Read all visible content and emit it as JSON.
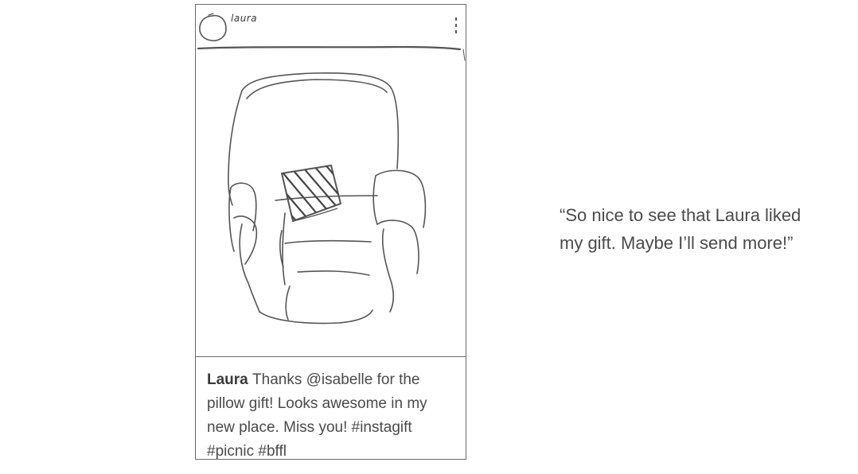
{
  "post": {
    "sketch_username": "laura",
    "caption_user": "Laura",
    "caption_text": "Thanks @isabelle for the pillow gift! Looks awesome in my new place. Miss you! #instagift #picnic #bffl"
  },
  "quote": {
    "text": "“So nice to see that Laura liked my gift. Maybe I’ll send more!”"
  },
  "icons": {
    "avatar": "avatar-circle-icon",
    "menu": "more-vertical-icon"
  }
}
